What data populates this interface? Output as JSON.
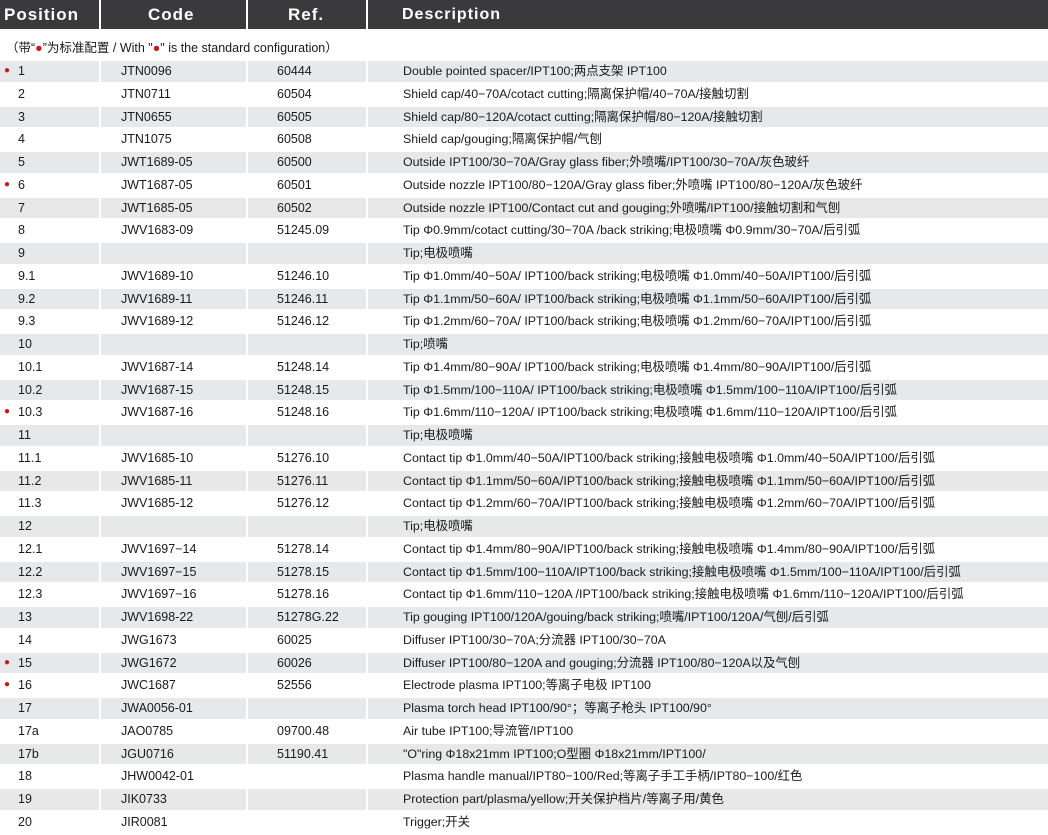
{
  "header": {
    "position": "Position",
    "code": "Code",
    "ref": "Ref.",
    "description": "Description"
  },
  "note": {
    "prefix": "（带“",
    "dot1": "●",
    "middle1": "”为标准配置 / With \"",
    "dot2": "●",
    "suffix": "\" is the standard configuration）"
  },
  "colors": {
    "header_bg": "#3a3a3c",
    "row_shade": "#e7e8ea",
    "standard_dot": "#d0141c"
  },
  "rows": [
    {
      "position": "1",
      "standard": true,
      "code": "JTN0096",
      "ref": "60444",
      "description": "Double pointed spacer/IPT100;两点支架 IPT100"
    },
    {
      "position": "2",
      "standard": false,
      "code": "JTN0711",
      "ref": "60504",
      "description": "Shield cap/40−70A/cotact cutting;隔离保护帽/40−70A/接触切割"
    },
    {
      "position": "3",
      "standard": false,
      "code": "JTN0655",
      "ref": "60505",
      "description": "Shield cap/80−120A/cotact cutting;隔离保护帽/80−120A/接触切割"
    },
    {
      "position": "4",
      "standard": false,
      "code": "JTN1075",
      "ref": "60508",
      "description": "Shield cap/gouging;隔离保护帽/气刨"
    },
    {
      "position": "5",
      "standard": false,
      "code": "JWT1689-05",
      "ref": "60500",
      "description": "Outside IPT100/30−70A/Gray glass fiber;外喷嘴/IPT100/30−70A/灰色玻纤"
    },
    {
      "position": "6",
      "standard": true,
      "code": "JWT1687-05",
      "ref": "60501",
      "description": "Outside nozzle IPT100/80−120A/Gray glass fiber;外喷嘴 IPT100/80−120A/灰色玻纤"
    },
    {
      "position": "7",
      "standard": false,
      "code": "JWT1685-05",
      "ref": "60502",
      "description": "Outside nozzle IPT100/Contact cut and gouging;外喷嘴/IPT100/接触切割和气刨"
    },
    {
      "position": "8",
      "standard": false,
      "code": "JWV1683-09",
      "ref": "51245.09",
      "description": "Tip Φ0.9mm/cotact cutting/30−70A /back striking;电极喷嘴 Φ0.9mm/30−70A/后引弧"
    },
    {
      "position": "9",
      "standard": false,
      "code": "",
      "ref": "",
      "description": "Tip;电极喷嘴"
    },
    {
      "position": "9.1",
      "standard": false,
      "code": "JWV1689-10",
      "ref": "51246.10",
      "description": "Tip Φ1.0mm/40−50A/ IPT100/back striking;电极喷嘴 Φ1.0mm/40−50A/IPT100/后引弧"
    },
    {
      "position": "9.2",
      "standard": false,
      "code": "JWV1689-11",
      "ref": "51246.11",
      "description": "Tip Φ1.1mm/50−60A/ IPT100/back striking;电极喷嘴 Φ1.1mm/50−60A/IPT100/后引弧"
    },
    {
      "position": "9.3",
      "standard": false,
      "code": "JWV1689-12",
      "ref": "51246.12",
      "description": "Tip Φ1.2mm/60−70A/ IPT100/back striking;电极喷嘴 Φ1.2mm/60−70A/IPT100/后引弧"
    },
    {
      "position": "10",
      "standard": false,
      "code": "",
      "ref": "",
      "description": "Tip;喷嘴"
    },
    {
      "position": "10.1",
      "standard": false,
      "code": "JWV1687-14",
      "ref": "51248.14",
      "description": "Tip Φ1.4mm/80−90A/ IPT100/back striking;电极喷嘴 Φ1.4mm/80−90A/IPT100/后引弧"
    },
    {
      "position": "10.2",
      "standard": false,
      "code": "JWV1687-15",
      "ref": "51248.15",
      "description": "Tip Φ1.5mm/100−110A/ IPT100/back striking;电极喷嘴 Φ1.5mm/100−110A/IPT100/后引弧"
    },
    {
      "position": "10.3",
      "standard": true,
      "code": "JWV1687-16",
      "ref": "51248.16",
      "description": "Tip Φ1.6mm/110−120A/ IPT100/back striking;电极喷嘴 Φ1.6mm/110−120A/IPT100/后引弧"
    },
    {
      "position": "11",
      "standard": false,
      "code": "",
      "ref": "",
      "description": "Tip;电极喷嘴"
    },
    {
      "position": "11.1",
      "standard": false,
      "code": "JWV1685-10",
      "ref": "51276.10",
      "description": "Contact tip Φ1.0mm/40−50A/IPT100/back striking;接触电极喷嘴 Φ1.0mm/40−50A/IPT100/后引弧"
    },
    {
      "position": "11.2",
      "standard": false,
      "code": "JWV1685-11",
      "ref": "51276.11",
      "description": "Contact tip Φ1.1mm/50−60A/IPT100/back striking;接触电极喷嘴 Φ1.1mm/50−60A/IPT100/后引弧"
    },
    {
      "position": "11.3",
      "standard": false,
      "code": "JWV1685-12",
      "ref": "51276.12",
      "description": "Contact tip Φ1.2mm/60−70A/IPT100/back striking;接触电极喷嘴 Φ1.2mm/60−70A/IPT100/后引弧"
    },
    {
      "position": "12",
      "standard": false,
      "code": "",
      "ref": "",
      "description": "Tip;电极喷嘴"
    },
    {
      "position": "12.1",
      "standard": false,
      "code": "JWV1697−14",
      "ref": "51278.14",
      "description": "Contact tip Φ1.4mm/80−90A/IPT100/back striking;接触电极喷嘴 Φ1.4mm/80−90A/IPT100/后引弧"
    },
    {
      "position": "12.2",
      "standard": false,
      "code": "JWV1697−15",
      "ref": "51278.15",
      "description": "Contact tip Φ1.5mm/100−110A/IPT100/back striking;接触电极喷嘴 Φ1.5mm/100−110A/IPT100/后引弧"
    },
    {
      "position": "12.3",
      "standard": false,
      "code": "JWV1697−16",
      "ref": "51278.16",
      "description": "Contact tip Φ1.6mm/110−120A /IPT100/back striking;接触电极喷嘴 Φ1.6mm/110−120A/IPT100/后引弧"
    },
    {
      "position": "13",
      "standard": false,
      "code": "JWV1698-22",
      "ref": "51278G.22",
      "description": "Tip gouging IPT100/120A/gouing/back striking;喷嘴/IPT100/120A/气刨/后引弧"
    },
    {
      "position": "14",
      "standard": false,
      "code": "JWG1673",
      "ref": "60025",
      "description": "Diffuser IPT100/30−70A;分流器 IPT100/30−70A"
    },
    {
      "position": "15",
      "standard": true,
      "code": "JWG1672",
      "ref": "60026",
      "description": "Diffuser IPT100/80−120A and gouging;分流器 IPT100/80−120A以及气刨"
    },
    {
      "position": "16",
      "standard": true,
      "code": "JWC1687",
      "ref": "52556",
      "description": "Electrode plasma IPT100;等离子电极 IPT100"
    },
    {
      "position": "17",
      "standard": false,
      "code": "JWA0056-01",
      "ref": "",
      "description": "Plasma torch head IPT100/90°；等离子枪头 IPT100/90°"
    },
    {
      "position": "17a",
      "standard": false,
      "code": "JAO0785",
      "ref": "09700.48",
      "description": "Air tube IPT100;导流管/IPT100"
    },
    {
      "position": "17b",
      "standard": false,
      "code": "JGU0716",
      "ref": "51190.41",
      "description": "\"O\"ring Φ18x21mm IPT100;O型圈 Φ18x21mm/IPT100/"
    },
    {
      "position": "18",
      "standard": false,
      "code": "JHW0042-01",
      "ref": "",
      "description": "Plasma handle manual/IPT80−100/Red;等离子手工手柄/IPT80−100/红色"
    },
    {
      "position": "19",
      "standard": false,
      "code": "JIK0733",
      "ref": "",
      "description": "Protection part/plasma/yellow;开关保护档片/等离子用/黄色"
    },
    {
      "position": "20",
      "standard": false,
      "code": "JIR0081",
      "ref": "",
      "description": "Trigger;开关"
    }
  ]
}
